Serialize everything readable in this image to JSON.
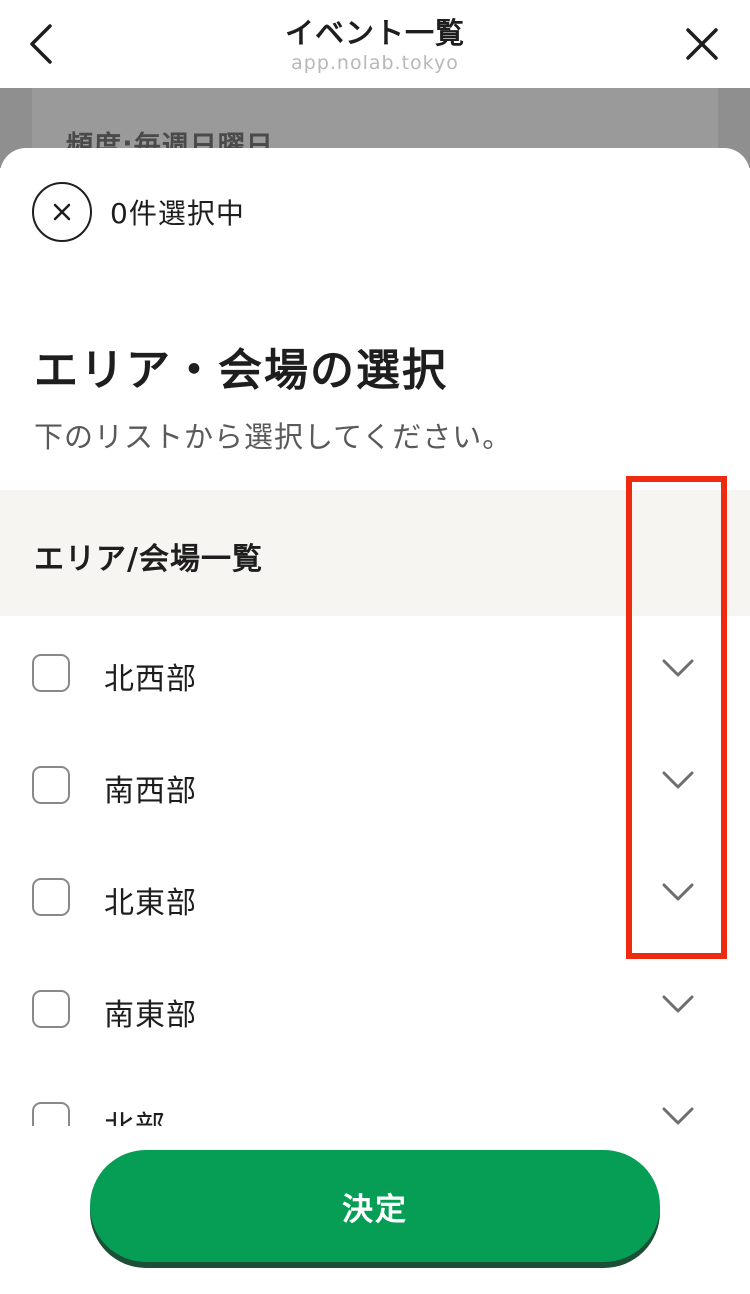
{
  "browser": {
    "title": "イベント一覧",
    "url": "app.nolab.tokyo"
  },
  "background_page": {
    "frequency_text": "頻度:毎週日曜日"
  },
  "sheet": {
    "selected_count_text": "0件選択中",
    "heading": "エリア・会場の選択",
    "subtext": "下のリストから選択してください。",
    "list_header": "エリア/会場一覧",
    "items": [
      {
        "label": "北西部",
        "checked": false
      },
      {
        "label": "南西部",
        "checked": false
      },
      {
        "label": "北東部",
        "checked": false
      },
      {
        "label": "南東部",
        "checked": false
      },
      {
        "label": "北部",
        "checked": false
      }
    ],
    "decide_label": "決定"
  },
  "colors": {
    "accent_green": "#069e55",
    "highlight_red": "#ee2a10"
  },
  "icons": [
    "back-icon",
    "close-icon",
    "clear-selection-icon",
    "chevron-down-icon"
  ]
}
